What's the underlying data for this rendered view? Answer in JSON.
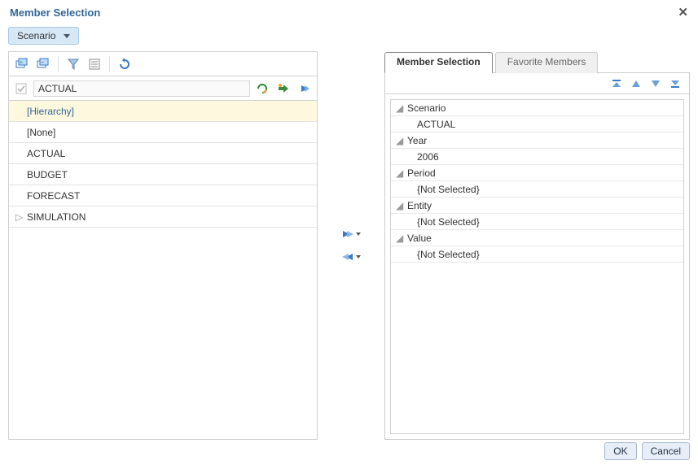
{
  "dialog": {
    "title": "Member Selection"
  },
  "dimension_selector": {
    "label": "Scenario"
  },
  "search": {
    "value": "ACTUAL"
  },
  "left_tree": {
    "hierarchy_label": "[Hierarchy]",
    "items": [
      "[None]",
      "ACTUAL",
      "BUDGET",
      "FORECAST",
      "SIMULATION"
    ]
  },
  "tabs": {
    "member_selection": "Member Selection",
    "favorite_members": "Favorite Members"
  },
  "right_tree": [
    {
      "dim": "Scenario",
      "value": "ACTUAL"
    },
    {
      "dim": "Year",
      "value": "2006"
    },
    {
      "dim": "Period",
      "value": "{Not Selected}"
    },
    {
      "dim": "Entity",
      "value": "{Not Selected}"
    },
    {
      "dim": "Value",
      "value": "{Not Selected}"
    }
  ],
  "buttons": {
    "ok": "OK",
    "cancel": "Cancel"
  }
}
